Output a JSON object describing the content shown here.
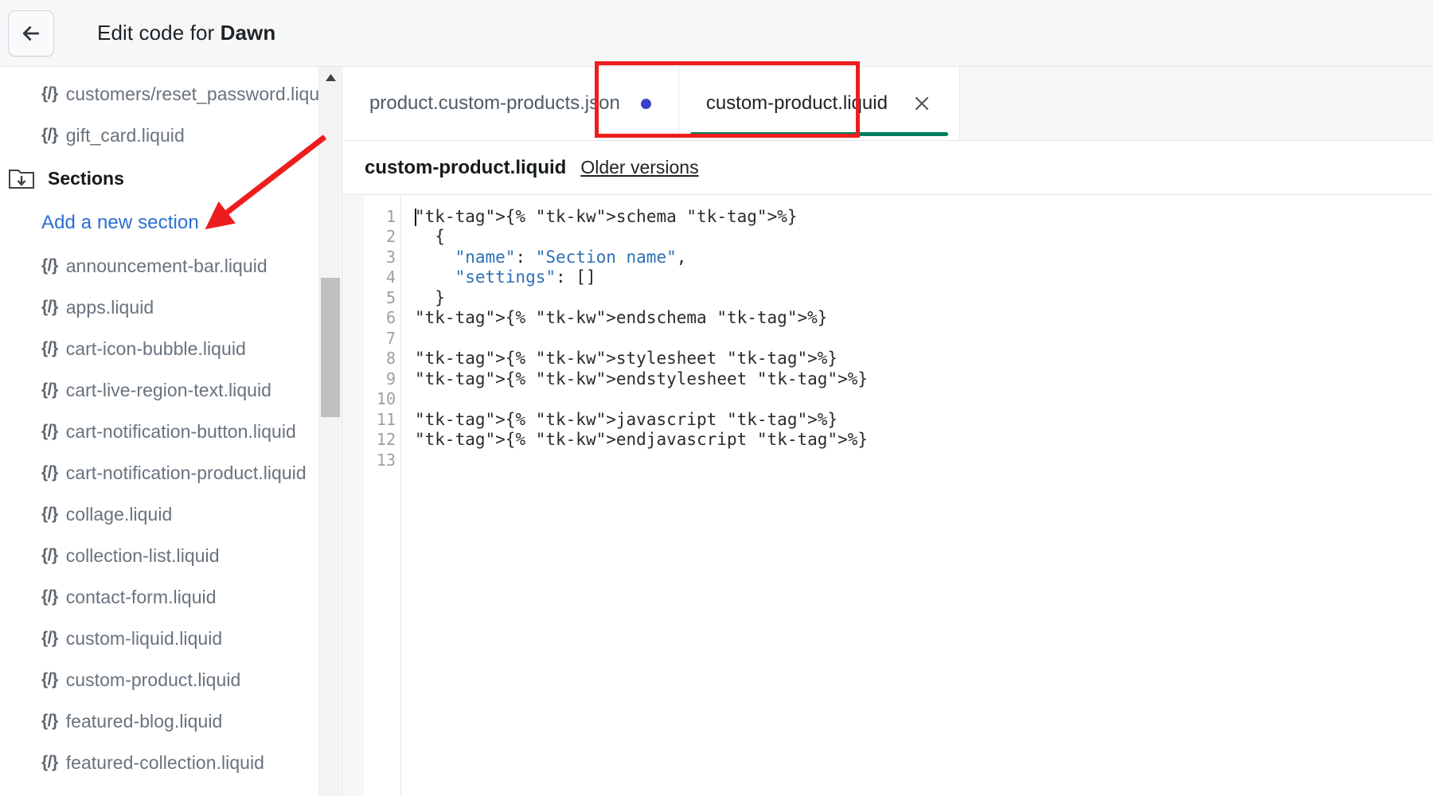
{
  "header": {
    "back_icon": "arrow-left-icon",
    "title_prefix": "Edit code for ",
    "title_theme": "Dawn"
  },
  "sidebar": {
    "scroll_up_icon": "triangle-up-icon",
    "items": [
      {
        "type": "file",
        "icon": "liquid-code-icon",
        "label": "customers/reset_password.liquid"
      },
      {
        "type": "file",
        "icon": "liquid-code-icon",
        "label": "gift_card.liquid"
      },
      {
        "type": "folder",
        "icon": "folder-collapse-icon",
        "label": "Sections"
      },
      {
        "type": "link",
        "label": "Add a new section"
      },
      {
        "type": "file",
        "icon": "liquid-code-icon",
        "label": "announcement-bar.liquid"
      },
      {
        "type": "file",
        "icon": "liquid-code-icon",
        "label": "apps.liquid"
      },
      {
        "type": "file",
        "icon": "liquid-code-icon",
        "label": "cart-icon-bubble.liquid"
      },
      {
        "type": "file",
        "icon": "liquid-code-icon",
        "label": "cart-live-region-text.liquid"
      },
      {
        "type": "file",
        "icon": "liquid-code-icon",
        "label": "cart-notification-button.liquid"
      },
      {
        "type": "file",
        "icon": "liquid-code-icon",
        "label": "cart-notification-product.liquid"
      },
      {
        "type": "file",
        "icon": "liquid-code-icon",
        "label": "collage.liquid"
      },
      {
        "type": "file",
        "icon": "liquid-code-icon",
        "label": "collection-list.liquid"
      },
      {
        "type": "file",
        "icon": "liquid-code-icon",
        "label": "contact-form.liquid"
      },
      {
        "type": "file",
        "icon": "liquid-code-icon",
        "label": "custom-liquid.liquid"
      },
      {
        "type": "file",
        "icon": "liquid-code-icon",
        "label": "custom-product.liquid"
      },
      {
        "type": "file",
        "icon": "liquid-code-icon",
        "label": "featured-blog.liquid"
      },
      {
        "type": "file",
        "icon": "liquid-code-icon",
        "label": "featured-collection.liquid"
      }
    ]
  },
  "editor": {
    "tabs": [
      {
        "label": "product.custom-products.json",
        "unsaved": true,
        "active": false
      },
      {
        "label": "custom-product.liquid",
        "unsaved": false,
        "active": true,
        "close_icon": "close-icon"
      }
    ],
    "file_header": {
      "filename": "custom-product.liquid",
      "older_versions_label": "Older versions"
    },
    "code": {
      "line_numbers": [
        "1",
        "2",
        "3",
        "4",
        "5",
        "6",
        "7",
        "8",
        "9",
        "10",
        "11",
        "12",
        "13"
      ],
      "lines": [
        {
          "n": "1",
          "text": "{% schema %}"
        },
        {
          "n": "2",
          "text": "  {"
        },
        {
          "n": "3",
          "text": "    \"name\": \"Section name\","
        },
        {
          "n": "4",
          "text": "    \"settings\": []"
        },
        {
          "n": "5",
          "text": "  }"
        },
        {
          "n": "6",
          "text": "{% endschema %}"
        },
        {
          "n": "7",
          "text": ""
        },
        {
          "n": "8",
          "text": "{% stylesheet %}"
        },
        {
          "n": "9",
          "text": "{% endstylesheet %}"
        },
        {
          "n": "10",
          "text": ""
        },
        {
          "n": "11",
          "text": "{% javascript %}"
        },
        {
          "n": "12",
          "text": "{% endjavascript %}"
        },
        {
          "n": "13",
          "text": ""
        }
      ]
    }
  },
  "annotations": {
    "highlight_color": "#ee1d1d",
    "arrow_from": "top-right",
    "arrow_to": "Add a new section"
  },
  "colors": {
    "accent_green": "#008060",
    "link_blue": "#2b6ed4",
    "unsaved_dot": "#3b41c7",
    "annotation_red": "#ee1d1d"
  }
}
